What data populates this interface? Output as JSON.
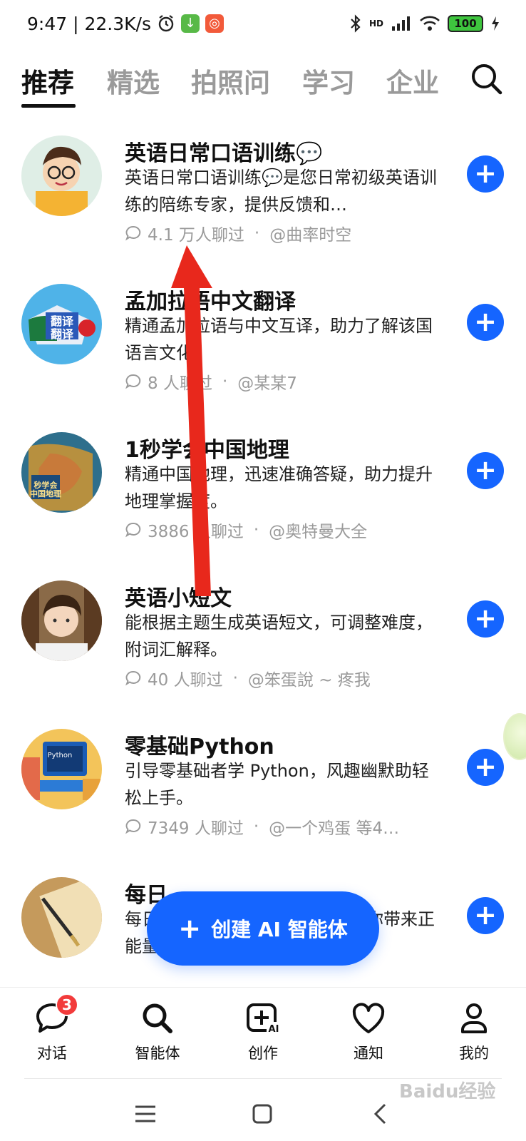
{
  "status_bar": {
    "time_speed": "9:47 | 22.3K/s",
    "network": "HD",
    "battery": "100"
  },
  "tabs": [
    {
      "label": "推荐",
      "active": true
    },
    {
      "label": "精选",
      "active": false
    },
    {
      "label": "拍照问",
      "active": false
    },
    {
      "label": "学习",
      "active": false
    },
    {
      "label": "企业",
      "active": false
    }
  ],
  "items": [
    {
      "title": "英语日常口语训练💬",
      "desc": "英语日常口语训练💬是您日常初级英语训练的陪练专家，提供反馈和…",
      "count": "4.1 万人聊过",
      "author": "@曲率时空"
    },
    {
      "title": "孟加拉语中文翻译",
      "desc": "精通孟加拉语与中文互译，助力了解该国语言文化。",
      "count": "8 人聊过",
      "author": "@某某7"
    },
    {
      "title": "1秒学会中国地理",
      "desc": "精通中国地理，迅速准确答疑，助力提升地理掌握度。",
      "count": "3886 人聊过",
      "author": "@奥特曼大全"
    },
    {
      "title": "英语小短文",
      "desc": "能根据主题生成英语短文，可调整难度，附词汇解释。",
      "count": "40 人聊过",
      "author": "@笨蛋說 ~ 疼我"
    },
    {
      "title": "零基础Python",
      "desc": "引导零基础者学 Python，风趣幽默助轻松上手。",
      "count": "7349 人聊过",
      "author": "@一个鸡蛋 等4…"
    },
    {
      "title": "每日",
      "desc": "每日                                   为你带来正能量。",
      "count": "",
      "author": ""
    }
  ],
  "create_button": {
    "label": "创建 AI 智能体"
  },
  "bottom_nav": [
    {
      "label": "对话",
      "badge": "3"
    },
    {
      "label": "智能体"
    },
    {
      "label": "创作"
    },
    {
      "label": "通知"
    },
    {
      "label": "我的"
    }
  ],
  "watermark": "Baidu经验",
  "colors": {
    "accent": "#1565ff",
    "arrow": "#e8281c",
    "badge": "#f23b3b"
  }
}
